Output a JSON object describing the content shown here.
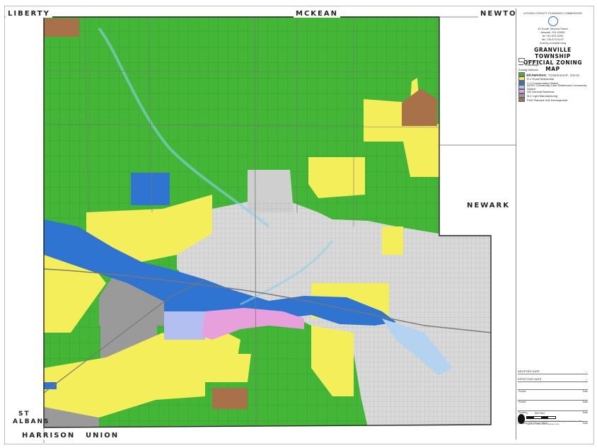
{
  "neighbors": {
    "liberty": "LIBERTY",
    "mckean": "MCKEAN",
    "newton": "NEWTON",
    "newark": "NEWARK",
    "st_albans_1": "ST",
    "st_albans_2": "ALBANS",
    "harrison": "HARRISON",
    "union": "UNION"
  },
  "title_block": {
    "commission": "LICKING COUNTY PLANNING COMMISSION",
    "address_1": "20 South Second Street",
    "address_2": "Newark, OH 43055",
    "phone": "tel 740.670.5200",
    "fax": "fax 740.670.5197",
    "web": "lcounty.com/planning",
    "title_1": "GRANVILLE TOWNSHIP",
    "title_2": "OFFICIAL ZONING MAP",
    "subtitle": "GRANVILLE TOWNSHIP, OHIO"
  },
  "legend": {
    "township": "Township",
    "roadways": "Roadways",
    "heading": "Zoning Districts",
    "items": [
      {
        "label": "AG Agriculture",
        "color": "#43b537"
      },
      {
        "label": "R-1 Rural Residential",
        "color": "#f4ee5a"
      },
      {
        "label": "C-1 Conservation District",
        "color": "#2f74d0"
      },
      {
        "label": "ACRC Community Care Retirement Community District",
        "color": "#b3bff0"
      },
      {
        "label": "GB General Business",
        "color": "#e8a0dc"
      },
      {
        "label": "M-1 Light Manufacturing",
        "color": "#9a9a9a"
      },
      {
        "label": "PUD Planned Unit Development",
        "color": "#a9714a"
      }
    ]
  },
  "signatures": {
    "adopted": "ADOPTED DATE",
    "effective": "EFFECTIVE DATE",
    "trustee_1": "Trustee",
    "trustee_2": "Trustee",
    "trustee_3": "Trustee",
    "fiscal": "Granville Twp Fiscal Officer",
    "date": "Date"
  },
  "scale": {
    "zero": "0",
    "label": "500 Feet"
  },
  "compiled": "Compiled by the Licking County Planning Commission. This map is for reference purposes only."
}
